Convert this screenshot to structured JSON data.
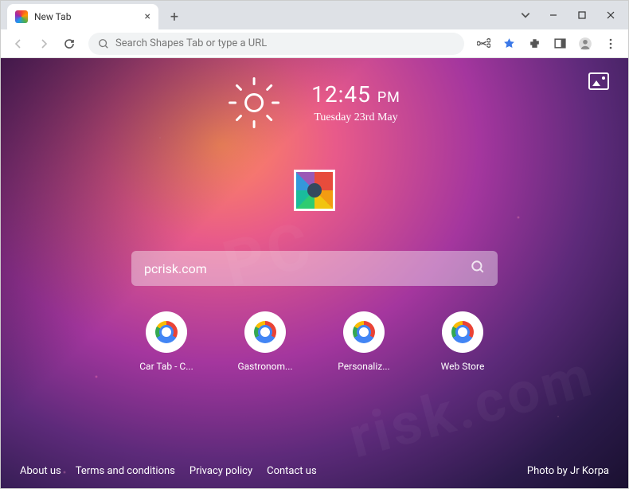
{
  "tab": {
    "title": "New Tab"
  },
  "omnibox": {
    "placeholder": "Search Shapes Tab or type a URL"
  },
  "widget": {
    "time": "12:45",
    "ampm": "PM",
    "date": "Tuesday 23rd May"
  },
  "search": {
    "value": "pcrisk.com"
  },
  "shortcuts": [
    {
      "label": "Car Tab - C..."
    },
    {
      "label": "Gastronom..."
    },
    {
      "label": "Personaliz..."
    },
    {
      "label": "Web Store"
    }
  ],
  "footer": {
    "links": [
      "About us",
      "Terms and conditions",
      "Privacy policy",
      "Contact us"
    ],
    "credit": "Photo by Jr Korpa"
  }
}
